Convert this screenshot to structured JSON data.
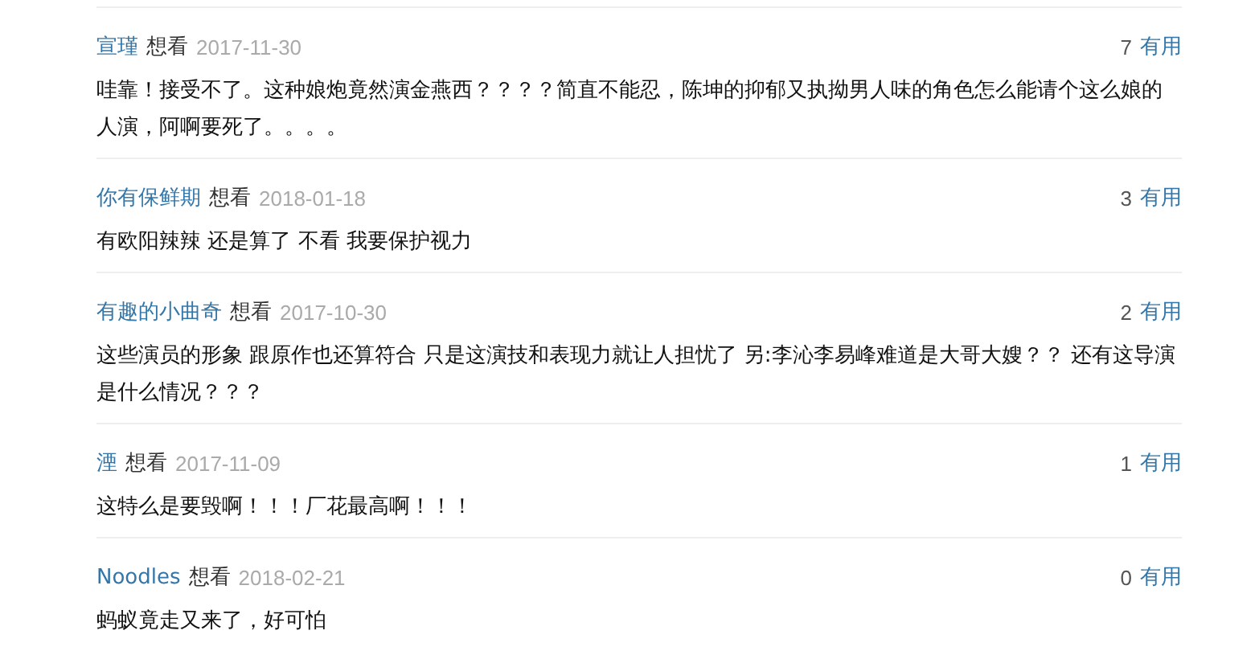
{
  "comments": [
    {
      "author": "宣瑾",
      "status": "想看",
      "date": "2017-11-30",
      "votes": "7",
      "vote_label": "有用",
      "text": "哇靠！接受不了。这种娘炮竟然演金燕西？？？？简直不能忍，陈坤的抑郁又执拗男人味的角色怎么能请个这么娘的人演，阿啊要死了。。。。"
    },
    {
      "author": "你有保鲜期",
      "status": "想看",
      "date": "2018-01-18",
      "votes": "3",
      "vote_label": "有用",
      "text": "有欧阳辣辣 还是算了 不看 我要保护视力"
    },
    {
      "author": "有趣的小曲奇",
      "status": "想看",
      "date": "2017-10-30",
      "votes": "2",
      "vote_label": "有用",
      "text": "这些演员的形象 跟原作也还算符合 只是这演技和表现力就让人担忧了 另:李沁李易峰难道是大哥大嫂？？ 还有这导演是什么情况？？？"
    },
    {
      "author": "湮",
      "status": "想看",
      "date": "2017-11-09",
      "votes": "1",
      "vote_label": "有用",
      "text": "这特么是要毁啊！！！厂花最高啊！！！"
    },
    {
      "author": "Noodles",
      "status": "想看",
      "date": "2018-02-21",
      "votes": "0",
      "vote_label": "有用",
      "text": "蚂蚁竟走又来了，好可怕"
    }
  ]
}
